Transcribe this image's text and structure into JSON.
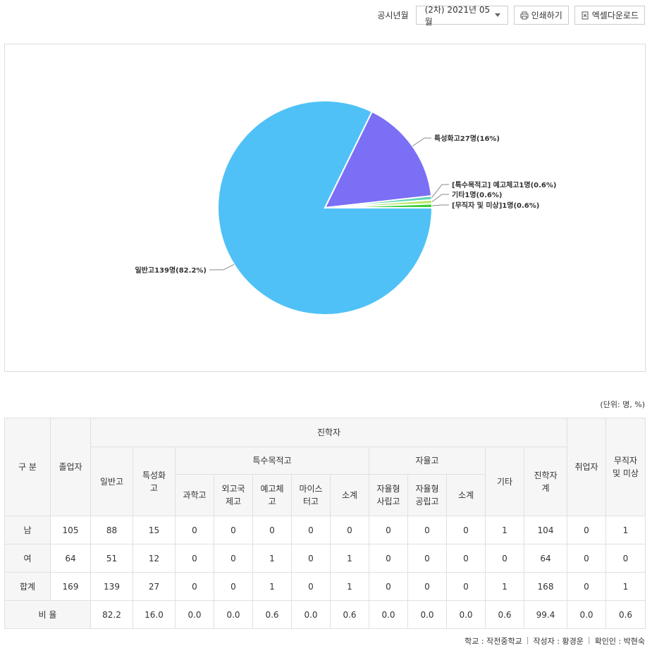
{
  "toolbar": {
    "year_label": "공시년월",
    "year_value": "(2차) 2021년 05월",
    "print_label": "인쇄하기",
    "excel_label": "엑셀다운로드"
  },
  "chart_data": {
    "type": "pie",
    "slices": [
      {
        "label": "일반고139명(82.2%)",
        "value": 139,
        "percent": 82.2,
        "color": "#4fc1f7"
      },
      {
        "label": "특성화고27명(16%)",
        "value": 27,
        "percent": 16.0,
        "color": "#7a6ff5"
      },
      {
        "label": "[특수목적고] 예고체고1명(0.6%)",
        "value": 1,
        "percent": 0.6,
        "color": "#5fd4b8"
      },
      {
        "label": "기타1명(0.6%)",
        "value": 1,
        "percent": 0.6,
        "color": "#b8e86a"
      },
      {
        "label": "[무직자 및 미상]1명(0.6%)",
        "value": 1,
        "percent": 0.6,
        "color": "#3bcf3b"
      }
    ]
  },
  "unit_label": "(단위: 명, %)",
  "table": {
    "h_gubun": "구 분",
    "h_graduates": "졸업자",
    "h_advance": "진학자",
    "h_employed": "취업자",
    "h_unemployed": "무직자\n및 미상",
    "h_general": "일반고",
    "h_special": "특성화\n고",
    "h_special_purpose": "특수목적고",
    "h_autonomous": "자율고",
    "h_other": "기타",
    "h_advance_total": "진학자\n계",
    "h_science": "과학고",
    "h_foreign": "외고국\n제고",
    "h_arts": "예고체\n고",
    "h_meister": "마이스\n터고",
    "h_subtotal1": "소계",
    "h_private": "자율형\n사립고",
    "h_public": "자율형\n공립고",
    "h_subtotal2": "소계",
    "rows": [
      {
        "label": "남",
        "values": [
          "105",
          "88",
          "15",
          "0",
          "0",
          "0",
          "0",
          "0",
          "0",
          "0",
          "0",
          "1",
          "104",
          "0",
          "1"
        ]
      },
      {
        "label": "여",
        "values": [
          "64",
          "51",
          "12",
          "0",
          "0",
          "1",
          "0",
          "1",
          "0",
          "0",
          "0",
          "0",
          "64",
          "0",
          "0"
        ]
      },
      {
        "label": "합계",
        "values": [
          "169",
          "139",
          "27",
          "0",
          "0",
          "1",
          "0",
          "1",
          "0",
          "0",
          "0",
          "1",
          "168",
          "0",
          "1"
        ]
      }
    ],
    "ratio_row": {
      "label": "비 율",
      "values": [
        "82.2",
        "16.0",
        "0.0",
        "0.0",
        "0.6",
        "0.0",
        "0.6",
        "0.0",
        "0.0",
        "0.0",
        "0.6",
        "99.4",
        "0.0",
        "0.6"
      ]
    }
  },
  "footer": {
    "school": "학교 : 작전중학교",
    "writer": "작성자 : 황경운",
    "confirmer": "확인인 : 박현숙"
  }
}
